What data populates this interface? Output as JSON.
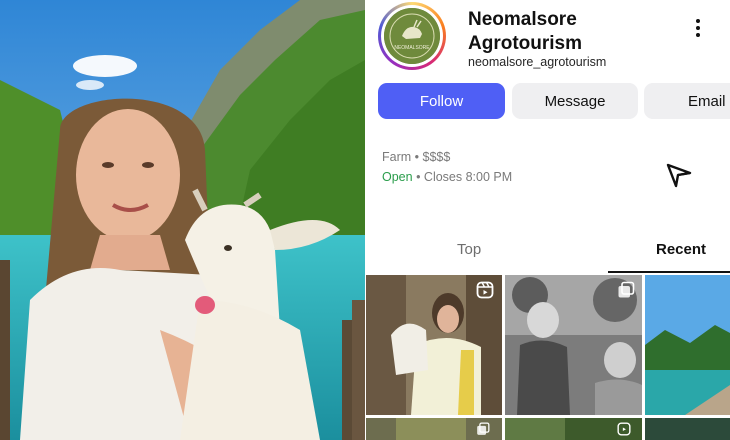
{
  "profile": {
    "name": "Neomalsore Agrotourism",
    "handle": "neomalsore_agrotourism",
    "avatar_icon": "goat-logo-icon",
    "avatar_text": "NEOMALSORE",
    "menu_icon": "more-vertical-icon"
  },
  "actions": {
    "follow_label": "Follow",
    "message_label": "Message",
    "email_label": "Email"
  },
  "business": {
    "category": "Farm",
    "price": "$$$$",
    "status": "Open",
    "closes": "Closes 8:00 PM",
    "share_icon": "send-icon"
  },
  "tabs": [
    {
      "label": "Top",
      "active": false
    },
    {
      "label": "Recent",
      "active": true
    }
  ],
  "colors": {
    "follow": "#4f5ff5",
    "open_status": "#2a9d4b",
    "avatar_bg": "#6f8a3c"
  },
  "grid_icons": [
    "reels-icon",
    "carousel-icon",
    "reels-icon"
  ]
}
